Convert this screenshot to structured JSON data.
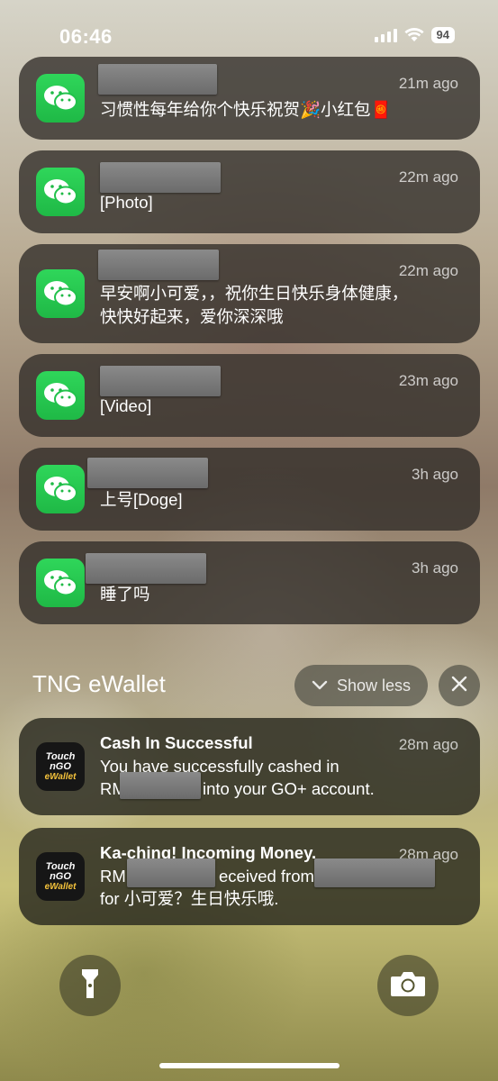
{
  "status": {
    "time": "06:46",
    "battery": "94"
  },
  "notifications": [
    {
      "time": "21m ago",
      "lines": [
        "习惯性每年给你个快乐祝贺🎉小红包🧧"
      ]
    },
    {
      "time": "22m ago",
      "lines": [
        "[Photo]"
      ]
    },
    {
      "time": "22m ago",
      "lines": [
        "早安啊小可爱，，祝你生日快乐身体健康，",
        "快快好起来，爱你深深哦"
      ]
    },
    {
      "time": "23m ago",
      "lines": [
        "[Video]"
      ]
    },
    {
      "time": "3h ago",
      "lines": [
        "上号[Doge]"
      ]
    },
    {
      "time": "3h ago",
      "lines": [
        "睡了吗"
      ]
    }
  ],
  "tng": {
    "group_title": "TNG eWallet",
    "show_less": "Show less",
    "icon_text_1": "Touch",
    "icon_text_2": "nGO",
    "icon_text_3": "eWallet",
    "items": [
      {
        "title": "Cash In Successful",
        "time": "28m ago",
        "line1": "You have successfully cashed in",
        "line2_prefix": "RM",
        "line2_suffix": "into your GO+ account."
      },
      {
        "title": "Ka-ching! Incoming Money.",
        "time": "28m ago",
        "line1_prefix": "RM",
        "line1_mid": "eceived from",
        "line2": "for 小可爱？生日快乐哦."
      }
    ]
  },
  "icons": {
    "app_icon": "wechat-icon",
    "flashlight": "flashlight-icon",
    "camera": "camera-icon"
  }
}
